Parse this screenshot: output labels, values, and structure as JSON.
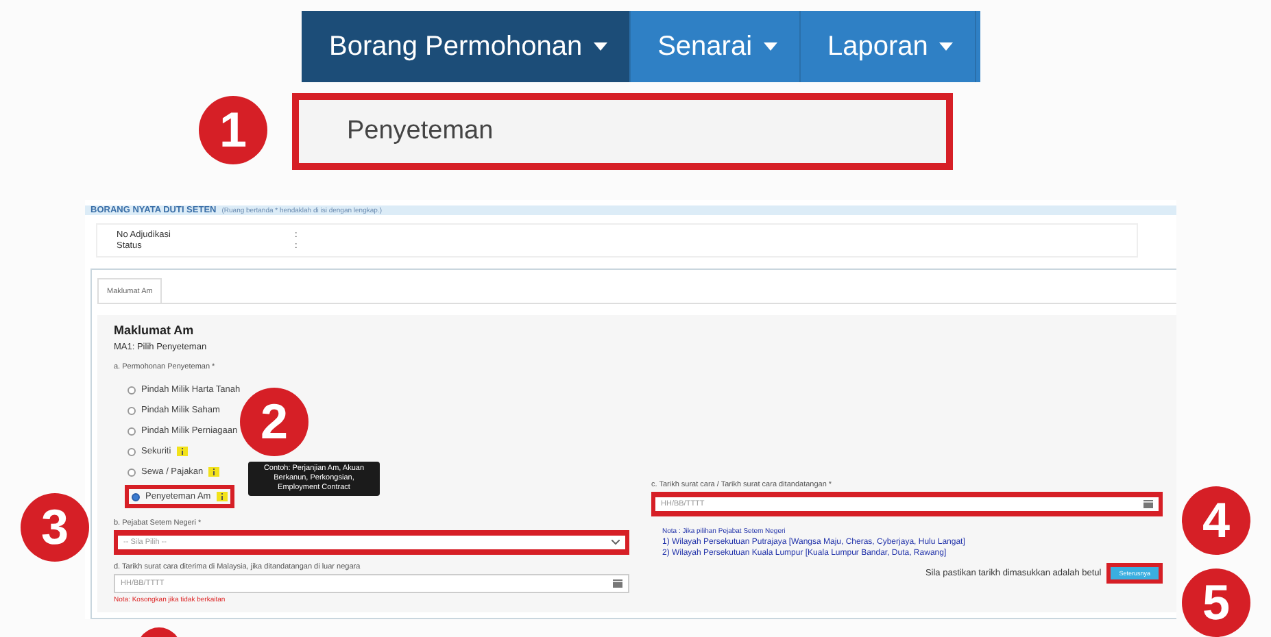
{
  "menu_bar": {
    "items": [
      {
        "label": "Borang Permohonan",
        "selected": true
      },
      {
        "label": "Senarai",
        "selected": false
      },
      {
        "label": "Laporan",
        "selected": false
      }
    ],
    "dropdown": {
      "items": [
        {
          "label": "Penyeteman",
          "highlighted": true
        }
      ]
    }
  },
  "form": {
    "header": {
      "title": "BORANG NYATA DUTI SETEN",
      "hint": "(Ruang bertanda * hendaklah di isi dengan lengkap.)"
    },
    "info": [
      {
        "label": "No Adjudikasi",
        "value": ":"
      },
      {
        "label": "Status",
        "value": ":"
      }
    ],
    "tabs": [
      {
        "label": "Maklumat Am",
        "selected": true
      }
    ],
    "section_title": "Maklumat Am",
    "subtitle": "MA1: Pilih Penyeteman",
    "question_a": {
      "label": "a. Permohonan Penyeteman *",
      "options": [
        {
          "label": "Pindah Milik Harta Tanah",
          "selected": false,
          "info": false,
          "highlighted": false
        },
        {
          "label": "Pindah Milik Saham",
          "selected": false,
          "info": false,
          "highlighted": false
        },
        {
          "label": "Pindah Milik Perniagaan",
          "selected": false,
          "info": false,
          "highlighted": false
        },
        {
          "label": "Sekuriti",
          "selected": false,
          "info": true,
          "highlighted": false
        },
        {
          "label": "Sewa / Pajakan",
          "selected": false,
          "info": true,
          "highlighted": false
        },
        {
          "label": "Penyeteman Am",
          "selected": true,
          "info": true,
          "highlighted": true
        }
      ],
      "tooltip": "Contoh: Perjanjian Am, Akuan Berkanun, Perkongsian, Employment Contract"
    },
    "question_b": {
      "label": "b. Pejabat Setem Negeri *",
      "placeholder": "-- Sila Pilih --",
      "highlighted": true
    },
    "question_c": {
      "label": "c. Tarikh surat cara / Tarikh surat cara ditandatangan *",
      "placeholder": "HH/BB/TTTT",
      "highlighted": true
    },
    "question_d": {
      "label": "d. Tarikh surat cara diterima di Malaysia, jika ditandatangan di luar negara",
      "placeholder": "HH/BB/TTTT",
      "highlighted": false,
      "note": "Nota: Kosongkan jika tidak berkaitan"
    },
    "notes": [
      "Nota : Jika pilihan Pejabat Setem Negeri",
      "1) Wilayah Persekutuan Putrajaya [Wangsa Maju, Cheras, Cyberjaya, Hulu Langat]",
      "2) Wilayah Persekutuan Kuala Lumpur [Kuala Lumpur Bandar, Duta, Rawang]"
    ],
    "confirm_text": "Sila pastikan tarikh dimasukkan adalah betul",
    "next_button": {
      "label": "Seterusnya",
      "highlighted": true
    }
  },
  "markers": [
    {
      "number": "1"
    },
    {
      "number": "2"
    },
    {
      "number": "3"
    },
    {
      "number": "4"
    },
    {
      "number": "5"
    }
  ]
}
